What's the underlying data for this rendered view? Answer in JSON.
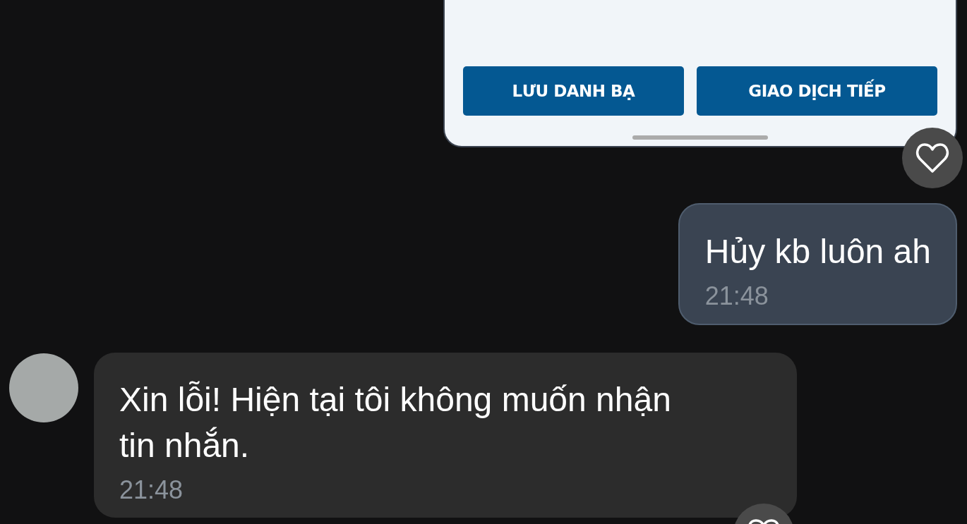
{
  "messages": [
    {
      "kind": "screenshot",
      "buttons": [
        "LƯU DANH BẠ",
        "GIAO DỊCH TIẾP"
      ]
    },
    {
      "kind": "text",
      "outgoing": true,
      "text": "Hủy kb luôn ah",
      "time": "21:48"
    },
    {
      "kind": "text",
      "outgoing": false,
      "text": "Xin lỗi! Hiện tại tôi không muốn nhận tin nhắn.",
      "time": "21:48"
    }
  ]
}
